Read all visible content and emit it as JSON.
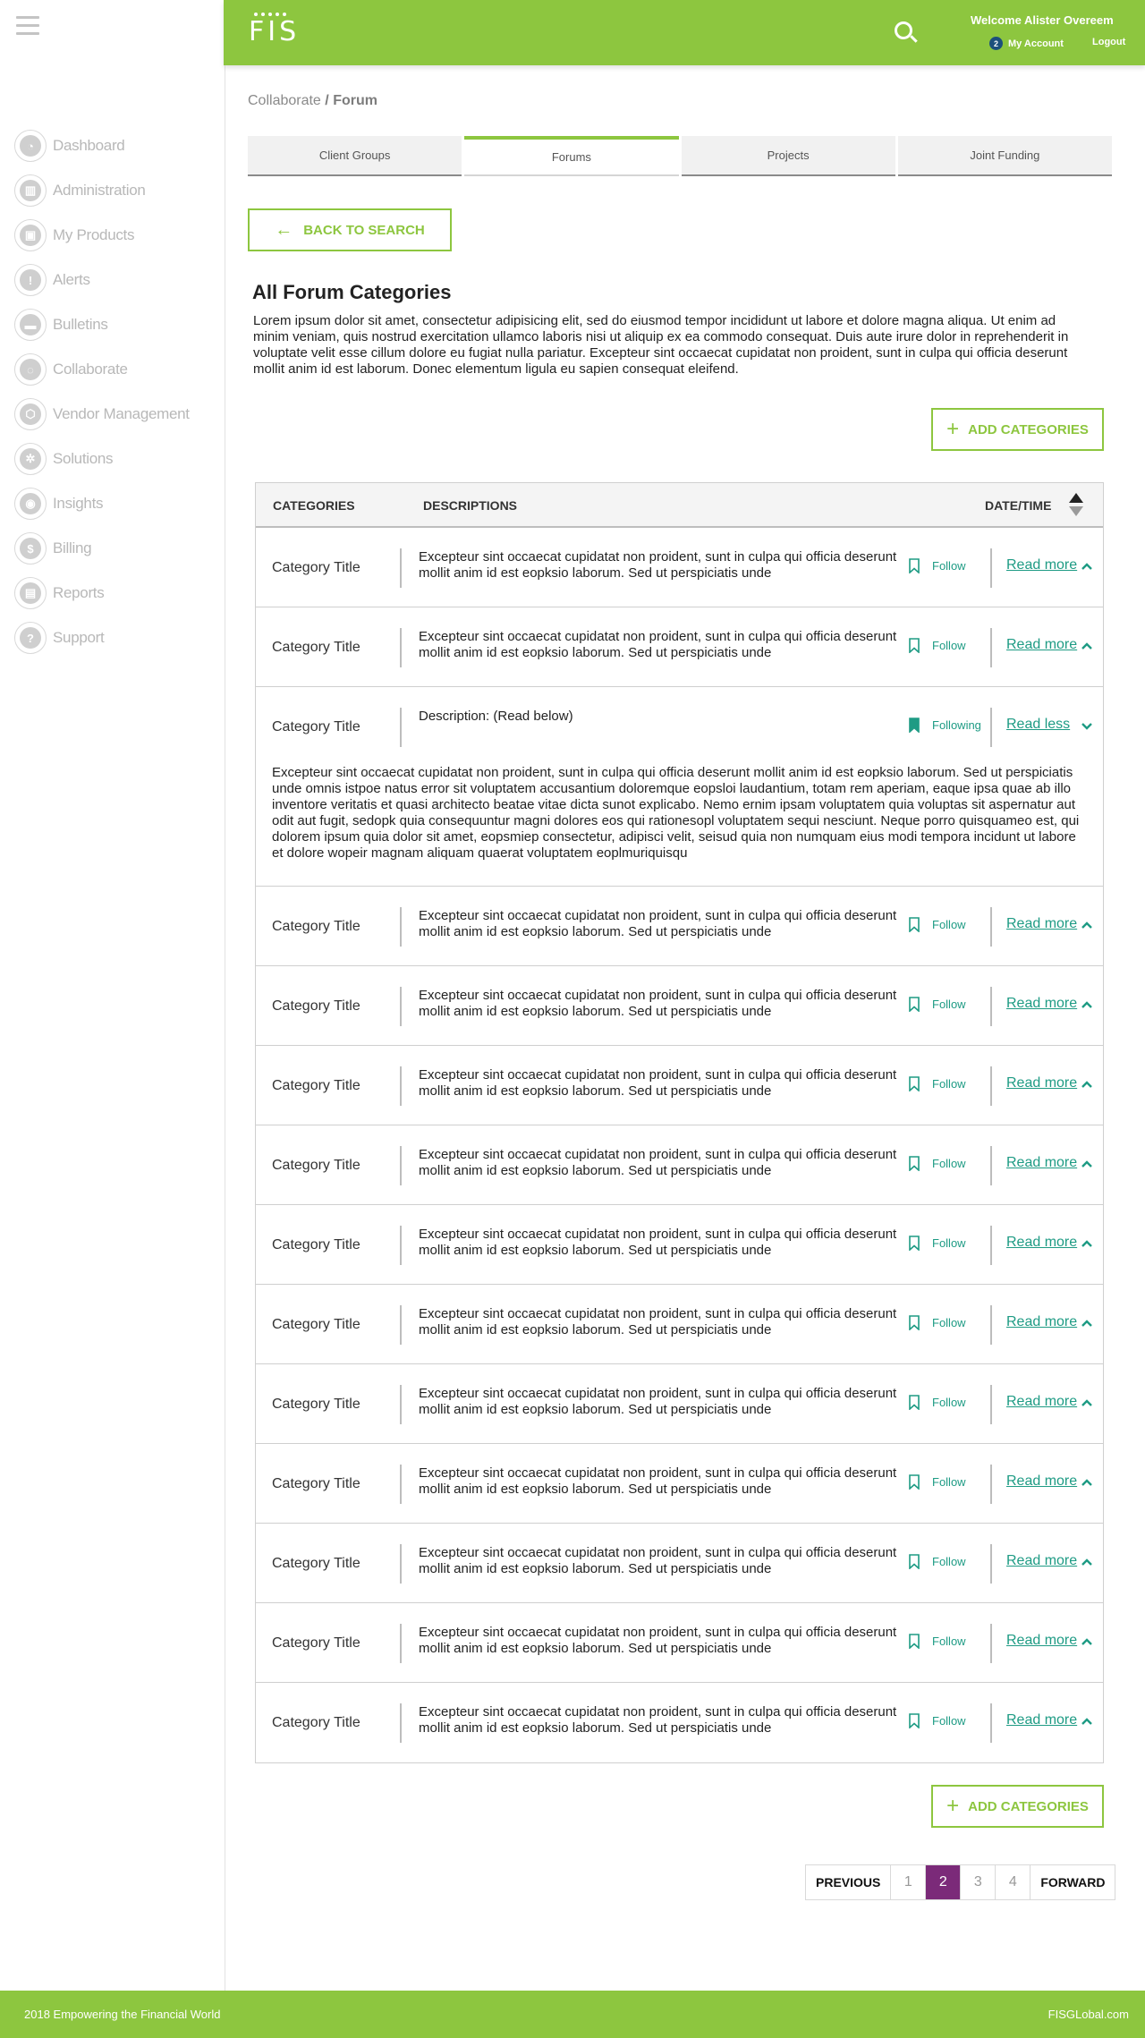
{
  "nav": [
    {
      "label": "Dashboard",
      "icon": "dashboard-icon",
      "glyph": "◔"
    },
    {
      "label": "Administration",
      "icon": "bank-icon",
      "glyph": "▥"
    },
    {
      "label": "My Products",
      "icon": "box-icon",
      "glyph": "▣"
    },
    {
      "label": "Alerts",
      "icon": "alert-icon",
      "glyph": "!"
    },
    {
      "label": "Bulletins",
      "icon": "folder-icon",
      "glyph": "▬"
    },
    {
      "label": "Collaborate",
      "icon": "chat-icon",
      "glyph": "◌"
    },
    {
      "label": "Vendor Management",
      "icon": "vendor-icon",
      "glyph": "⬡"
    },
    {
      "label": "Solutions",
      "icon": "gears-icon",
      "glyph": "✲"
    },
    {
      "label": "Insights",
      "icon": "lightbulb-icon",
      "glyph": "◉"
    },
    {
      "label": "Billing",
      "icon": "billing-icon",
      "glyph": "$"
    },
    {
      "label": "Reports",
      "icon": "reports-icon",
      "glyph": "▤"
    },
    {
      "label": "Support",
      "icon": "help-icon",
      "glyph": "?"
    }
  ],
  "header": {
    "logo": "FIS",
    "welcome": "Welcome Alister Overeem",
    "account_badge": "2",
    "account_label": "My Account",
    "logout": "Logout"
  },
  "breadcrumb": {
    "parent": "Collaborate",
    "separator": "/",
    "current": "Forum"
  },
  "tabs": [
    "Client Groups",
    "Forums",
    "Projects",
    "Joint Funding"
  ],
  "back_label": "BACK TO SEARCH",
  "section_title": "All Forum Categories",
  "intro": "Lorem ipsum dolor sit amet, consectetur adipisicing elit, sed do eiusmod tempor incididunt ut labore et dolore magna aliqua. Ut enim ad minim veniam, quis nostrud exercitation ullamco laboris nisi ut aliquip ex ea commodo consequat. Duis aute irure dolor in reprehenderit in voluptate velit esse cillum dolore eu fugiat nulla pariatur. Excepteur sint occaecat cupidatat non proident, sunt in culpa qui officia deserunt mollit anim id est laborum. Donec elementum ligula eu sapien consequat eleifend.",
  "add_label": "ADD CATEGORIES",
  "table": {
    "headers": {
      "categories": "CATEGORIES",
      "descriptions": "DESCRIPTIONS",
      "datetime": "DATE/TIME"
    },
    "rows": [
      {
        "title": "Category Title",
        "desc": "Excepteur sint occaecat cupidatat non proident, sunt in culpa qui officia deserunt mollit anim id est eopksio laborum. Sed ut perspiciatis unde",
        "follow": "Follow",
        "more": "Read more"
      },
      {
        "title": "Category Title",
        "desc": "Excepteur sint occaecat cupidatat non proident, sunt in culpa qui officia deserunt mollit anim id est eopksio laborum. Sed ut perspiciatis unde",
        "follow": "Follow",
        "more": "Read more"
      },
      {
        "title": "Category Title",
        "desc": "Description: (Read below)",
        "follow": "Following",
        "more": "Read less",
        "expanded": true,
        "full": "Excepteur sint occaecat cupidatat non proident, sunt in culpa qui officia deserunt mollit anim id est eopksio laborum. Sed ut perspiciatis unde omnis istpoe natus error sit voluptatem accusantium doloremque eopsloi laudantium, totam rem aperiam, eaque ipsa quae ab illo inventore veritatis et quasi architecto beatae vitae dicta sunot explicabo. Nemo ernim ipsam voluptatem quia voluptas sit aspernatur aut odit aut fugit, sedopk quia consequuntur magni dolores eos qui rationesopl voluptatem sequi nesciunt. Neque porro quisquameo est, qui dolorem ipsum quia dolor sit amet, eopsmiep consectetur, adipisci velit, seisud quia non numquam eius modi tempora incidunt ut labore et dolore wopeir magnam aliquam quaerat voluptatem eoplmuriquisqu"
      },
      {
        "title": "Category Title",
        "desc": "Excepteur sint occaecat cupidatat non proident, sunt in culpa qui officia deserunt mollit anim id est eopksio laborum. Sed ut perspiciatis unde",
        "follow": "Follow",
        "more": "Read more"
      },
      {
        "title": "Category Title",
        "desc": "Excepteur sint occaecat cupidatat non proident, sunt in culpa qui officia deserunt mollit anim id est eopksio laborum. Sed ut perspiciatis unde",
        "follow": "Follow",
        "more": "Read more"
      },
      {
        "title": "Category Title",
        "desc": "Excepteur sint occaecat cupidatat non proident, sunt in culpa qui officia deserunt mollit anim id est eopksio laborum. Sed ut perspiciatis unde",
        "follow": "Follow",
        "more": "Read more"
      },
      {
        "title": "Category Title",
        "desc": "Excepteur sint occaecat cupidatat non proident, sunt in culpa qui officia deserunt mollit anim id est eopksio laborum. Sed ut perspiciatis unde",
        "follow": "Follow",
        "more": "Read more"
      },
      {
        "title": "Category Title",
        "desc": "Excepteur sint occaecat cupidatat non proident, sunt in culpa qui officia deserunt mollit anim id est eopksio laborum. Sed ut perspiciatis unde",
        "follow": "Follow",
        "more": "Read more"
      },
      {
        "title": "Category Title",
        "desc": "Excepteur sint occaecat cupidatat non proident, sunt in culpa qui officia deserunt mollit anim id est eopksio laborum. Sed ut perspiciatis unde",
        "follow": "Follow",
        "more": "Read more"
      },
      {
        "title": "Category Title",
        "desc": "Excepteur sint occaecat cupidatat non proident, sunt in culpa qui officia deserunt mollit anim id est eopksio laborum. Sed ut perspiciatis unde",
        "follow": "Follow",
        "more": "Read more"
      },
      {
        "title": "Category Title",
        "desc": "Excepteur sint occaecat cupidatat non proident, sunt in culpa qui officia deserunt mollit anim id est eopksio laborum. Sed ut perspiciatis unde",
        "follow": "Follow",
        "more": "Read more"
      },
      {
        "title": "Category Title",
        "desc": "Excepteur sint occaecat cupidatat non proident, sunt in culpa qui officia deserunt mollit anim id est eopksio laborum. Sed ut perspiciatis unde",
        "follow": "Follow",
        "more": "Read more"
      },
      {
        "title": "Category Title",
        "desc": "Excepteur sint occaecat cupidatat non proident, sunt in culpa qui officia deserunt mollit anim id est eopksio laborum. Sed ut perspiciatis unde",
        "follow": "Follow",
        "more": "Read more"
      },
      {
        "title": "Category Title",
        "desc": "Excepteur sint occaecat cupidatat non proident, sunt in culpa qui officia deserunt mollit anim id est eopksio laborum. Sed ut perspiciatis unde",
        "follow": "Follow",
        "more": "Read more"
      }
    ]
  },
  "pagination": {
    "previous": "PREVIOUS",
    "pages": [
      "1",
      "2",
      "3",
      "4"
    ],
    "active": "2",
    "forward": "FORWARD"
  },
  "footer": {
    "left": "2018 Empowering the Financial World",
    "right": "FISGLobal.com"
  },
  "colors": {
    "brand_green": "#8dc63f",
    "teal_link": "#1e9b84",
    "active_page": "#7b2a79"
  }
}
